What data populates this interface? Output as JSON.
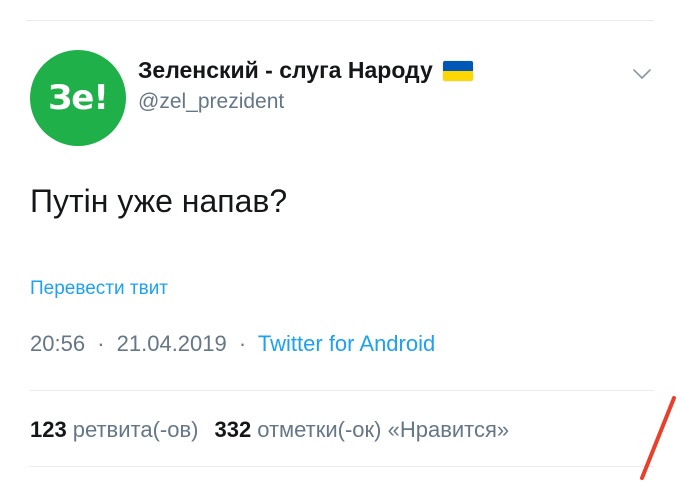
{
  "profile": {
    "avatar_text": "Зе!",
    "display_name": "Зеленский - слуга Народу",
    "handle": "@zel_prezident",
    "avatar_color": "#1fb049"
  },
  "tweet": {
    "text": "Путін уже напав?",
    "translate_label": "Перевести твит",
    "time": "20:56",
    "date": "21.04.2019",
    "separator": "·",
    "source": "Twitter for Android"
  },
  "stats": {
    "retweets_count": "123",
    "retweets_label": "ретвита(-ов)",
    "likes_count": "332",
    "likes_label": "отметки(-ок) «Нравится»"
  },
  "icons": {
    "menu": "chevron-down-icon",
    "flag": "ukraine-flag-icon"
  },
  "colors": {
    "link": "#1da1f2",
    "secondary_text": "#657786",
    "primary_text": "#14171a",
    "annotation": "#e8402a"
  }
}
